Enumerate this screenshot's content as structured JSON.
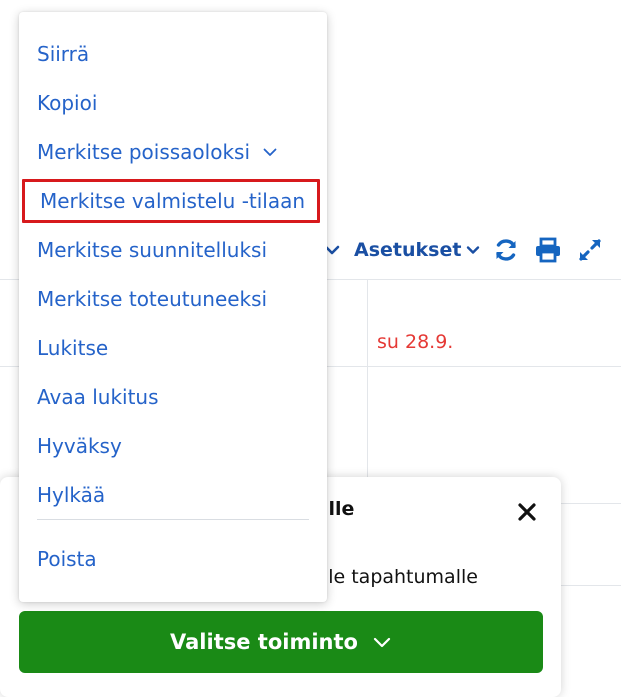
{
  "toolbar": {
    "settings_label": "Asetukset",
    "icons": [
      "chevron-down-icon",
      "refresh-icon",
      "print-icon",
      "fullscreen-icon"
    ],
    "accent": "#1a4fa3"
  },
  "table": {
    "date_label": "su 28.9.",
    "weekend_color": "#e53935"
  },
  "panel": {
    "title_partial": "htumille",
    "text_partial": "valitulle tapahtumalle",
    "action_button_label": "Valitse toiminto",
    "action_button_color": "#1a8a16"
  },
  "menu": {
    "items": [
      {
        "label": "Siirrä"
      },
      {
        "label": "Kopioi"
      },
      {
        "label": "Merkitse poissaoloksi",
        "has_submenu": true
      },
      {
        "label": "Merkitse valmistelu -tilaan",
        "highlighted": true
      },
      {
        "label": "Merkitse suunnitelluksi"
      },
      {
        "label": "Merkitse toteutuneeksi"
      },
      {
        "label": "Lukitse"
      },
      {
        "label": "Avaa lukitus"
      },
      {
        "label": "Hyväksy"
      },
      {
        "label": "Hylkää"
      },
      {
        "label": "Poista"
      }
    ],
    "link_color": "#2563c9",
    "highlight_color": "#d7191c"
  }
}
